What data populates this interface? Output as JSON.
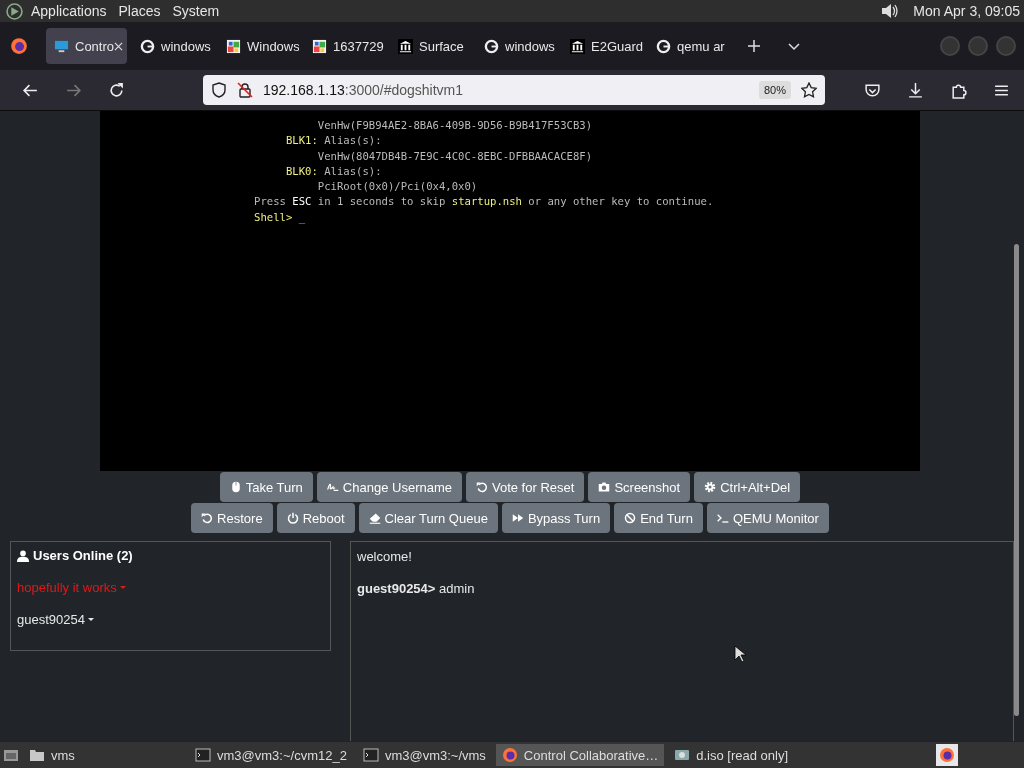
{
  "top_panel": {
    "menus": [
      "Applications",
      "Places",
      "System"
    ],
    "clock": "Mon Apr  3, 09:05"
  },
  "tabs": [
    {
      "title": "Contro",
      "kind": "monitor",
      "selected": true
    },
    {
      "title": "windows",
      "kind": "google",
      "selected": false
    },
    {
      "title": "Windows",
      "kind": "ba",
      "selected": false
    },
    {
      "title": "1637729",
      "kind": "ba",
      "selected": false
    },
    {
      "title": "Surface",
      "kind": "museum",
      "selected": false
    },
    {
      "title": "windows",
      "kind": "google",
      "selected": false
    },
    {
      "title": "E2Guard",
      "kind": "museum",
      "selected": false
    },
    {
      "title": "qemu ar",
      "kind": "google",
      "selected": false
    }
  ],
  "address_bar": {
    "host": "192.168.1.13",
    "path": ":3000/#dogshitvm1",
    "zoom": "80%"
  },
  "terminal": [
    {
      "kind": "path",
      "segments": [
        {
          "kind": "plain",
          "text": "VenHw(F9B94AE2-8BA6-409B-9D56-B9B417F53CB3)"
        }
      ]
    },
    {
      "kind": "device",
      "segments": [
        {
          "kind": "keyword",
          "text": "BLK1:"
        },
        {
          "kind": "plain",
          "text": " Alias(s):"
        }
      ]
    },
    {
      "kind": "path",
      "segments": [
        {
          "kind": "plain",
          "text": "VenHw(8047DB4B-7E9C-4C0C-8EBC-DFBBAACACE8F)"
        }
      ]
    },
    {
      "kind": "device",
      "segments": [
        {
          "kind": "keyword",
          "text": "BLK0:"
        },
        {
          "kind": "plain",
          "text": " Alias(s):"
        }
      ]
    },
    {
      "kind": "path",
      "segments": [
        {
          "kind": "plain",
          "text": "PciRoot(0x0)/Pci(0x4,0x0)"
        }
      ]
    },
    {
      "kind": "message",
      "segments": [
        {
          "kind": "plain",
          "text": "Press "
        },
        {
          "kind": "bright",
          "text": "ESC"
        },
        {
          "kind": "plain",
          "text": " in 1 seconds to skip "
        },
        {
          "kind": "keyword",
          "text": "startup.nsh"
        },
        {
          "kind": "plain",
          "text": " or any other key to continue."
        }
      ]
    },
    {
      "kind": "message",
      "segments": [
        {
          "kind": "keyword",
          "text": "Shell>"
        },
        {
          "kind": "plain",
          "text": " _"
        }
      ]
    }
  ],
  "button_rows": [
    [
      {
        "label": "Take Turn",
        "kind": "mouse"
      },
      {
        "label": "Change Username",
        "kind": "signature"
      },
      {
        "label": "Vote for Reset",
        "kind": "undo"
      },
      {
        "label": "Screenshot",
        "kind": "camera"
      },
      {
        "label": "Ctrl+Alt+Del",
        "kind": "gear"
      }
    ],
    [
      {
        "label": "Restore",
        "kind": "undo"
      },
      {
        "label": "Reboot",
        "kind": "power"
      },
      {
        "label": "Clear Turn Queue",
        "kind": "eraser"
      },
      {
        "label": "Bypass Turn",
        "kind": "forward"
      },
      {
        "label": "End Turn",
        "kind": "ban"
      },
      {
        "label": "QEMU Monitor",
        "kind": "terminal"
      }
    ]
  ],
  "users_panel": {
    "title": "Users Online (2)",
    "users": [
      {
        "name": "hopefully it works",
        "color": "#dc1a1a"
      },
      {
        "name": "guest90254",
        "color": "#e8e8e8"
      }
    ]
  },
  "chat": [
    "welcome!",
    "**guest90254>** admin"
  ],
  "taskbar": [
    {
      "label": "vms",
      "kind": "folder",
      "selected": false
    },
    {
      "label": "vm3@vm3:~/cvm12_2",
      "kind": "terminal",
      "selected": false
    },
    {
      "label": "vm3@vm3:~/vms",
      "kind": "terminal",
      "selected": false
    },
    {
      "label": "Control Collaborative…",
      "kind": "firefox",
      "selected": true
    },
    {
      "label": "d.iso [read only]",
      "kind": "disk",
      "selected": false
    }
  ]
}
